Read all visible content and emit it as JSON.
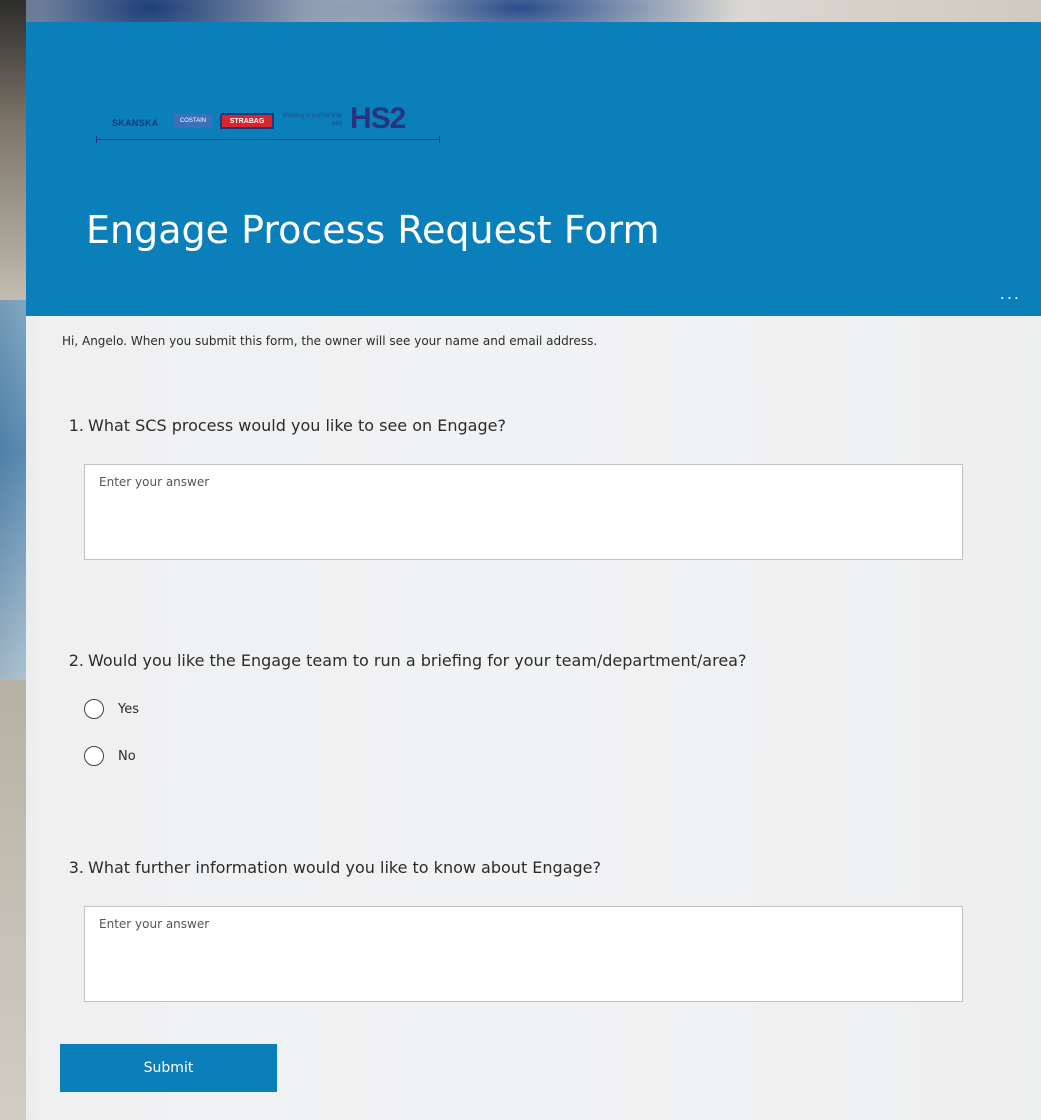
{
  "header": {
    "logo": {
      "skanska": "SKANSKA",
      "costain": "COSTAIN",
      "strabag": "STRABAG",
      "partnership": "Working in partnership with",
      "hs2": "HS2"
    },
    "title": "Engage Process Request Form",
    "more_label": "..."
  },
  "notice": "Hi, Angelo. When you submit this form, the owner will see your name and email address.",
  "questions": [
    {
      "number": "1.",
      "text": "What SCS process would you like to see on Engage?",
      "placeholder": "Enter your answer"
    },
    {
      "number": "2.",
      "text": "Would you like the Engage team to run a briefing for your team/department/area?",
      "options": [
        "Yes",
        "No"
      ]
    },
    {
      "number": "3.",
      "text": "What further information would you like to know about Engage?",
      "placeholder": "Enter your answer"
    }
  ],
  "submit_label": "Submit",
  "colors": {
    "header": "#0a7fba",
    "button": "#0a7fba",
    "text": "#2b2b2b"
  }
}
